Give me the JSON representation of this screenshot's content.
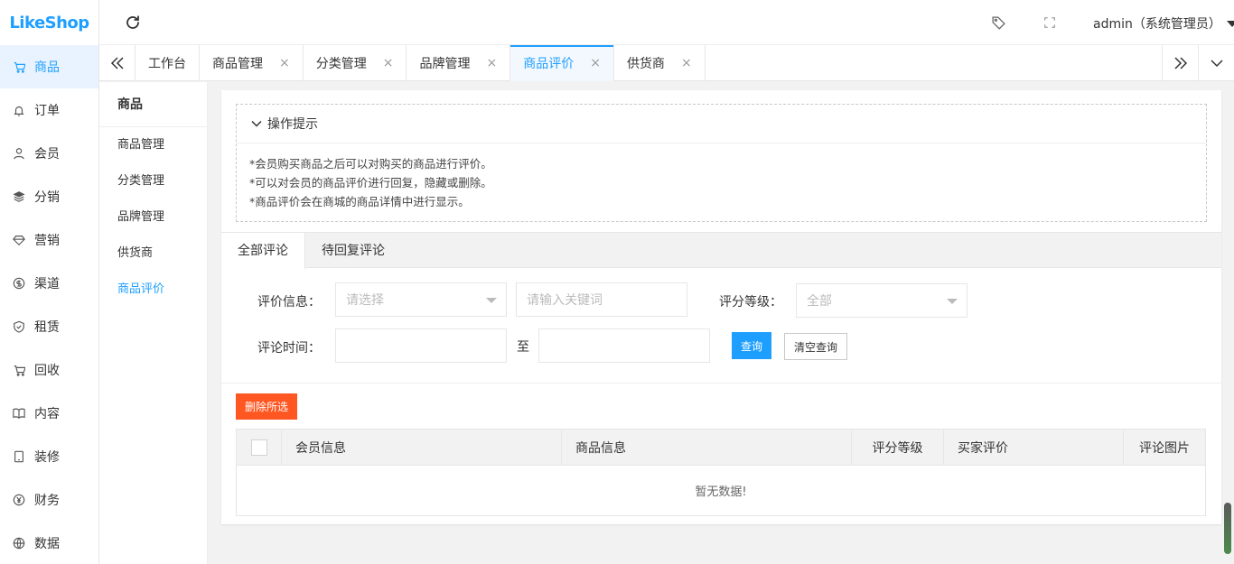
{
  "app": {
    "logo_text": "LikeShop"
  },
  "nav": {
    "items": [
      {
        "label": "商品",
        "icon": "cart-icon",
        "active": true
      },
      {
        "label": "订单",
        "icon": "bell-icon"
      },
      {
        "label": "会员",
        "icon": "user-icon"
      },
      {
        "label": "分销",
        "icon": "layers-icon"
      },
      {
        "label": "营销",
        "icon": "diamond-icon"
      },
      {
        "label": "渠道",
        "icon": "dollar-icon"
      },
      {
        "label": "租赁",
        "icon": "shield-icon"
      },
      {
        "label": "回收",
        "icon": "cart-icon"
      },
      {
        "label": "内容",
        "icon": "book-icon"
      },
      {
        "label": "装修",
        "icon": "tablet-icon"
      },
      {
        "label": "财务",
        "icon": "yen-icon"
      },
      {
        "label": "数据",
        "icon": "globe-icon"
      }
    ]
  },
  "header": {
    "user": "admin（系统管理员）"
  },
  "tabs": [
    {
      "label": "工作台",
      "closable": false
    },
    {
      "label": "商品管理",
      "closable": true
    },
    {
      "label": "分类管理",
      "closable": true
    },
    {
      "label": "品牌管理",
      "closable": true
    },
    {
      "label": "商品评价",
      "closable": true,
      "active": true
    },
    {
      "label": "供货商",
      "closable": true
    }
  ],
  "tab_close": "×",
  "subnav": {
    "title": "商品",
    "items": [
      {
        "label": "商品管理"
      },
      {
        "label": "分类管理"
      },
      {
        "label": "品牌管理"
      },
      {
        "label": "供货商"
      },
      {
        "label": "商品评价",
        "active": true
      }
    ]
  },
  "tips": {
    "title": "操作提示",
    "lines": [
      "*会员购买商品之后可以对购买的商品进行评价。",
      "*可以对会员的商品评价进行回复，隐藏或删除。",
      "*商品评价会在商城的商品详情中进行显示。"
    ]
  },
  "review_tabs": [
    {
      "label": "全部评论",
      "active": true
    },
    {
      "label": "待回复评论"
    }
  ],
  "filters": {
    "review_info_label": "评价信息：",
    "review_info_placeholder": "请选择",
    "keyword_placeholder": "请输入关键词",
    "rating_label": "评分等级：",
    "rating_value": "全部",
    "time_label": "评论时间：",
    "time_separator": "至",
    "search_button": "查询",
    "clear_button": "清空查询"
  },
  "actions": {
    "delete_selected": "删除所选"
  },
  "table": {
    "columns": [
      "会员信息",
      "商品信息",
      "评分等级",
      "买家评价",
      "评论图片"
    ],
    "empty_text": "暂无数据!"
  },
  "colors": {
    "accent": "#1e9fff",
    "danger": "#ff5722"
  }
}
